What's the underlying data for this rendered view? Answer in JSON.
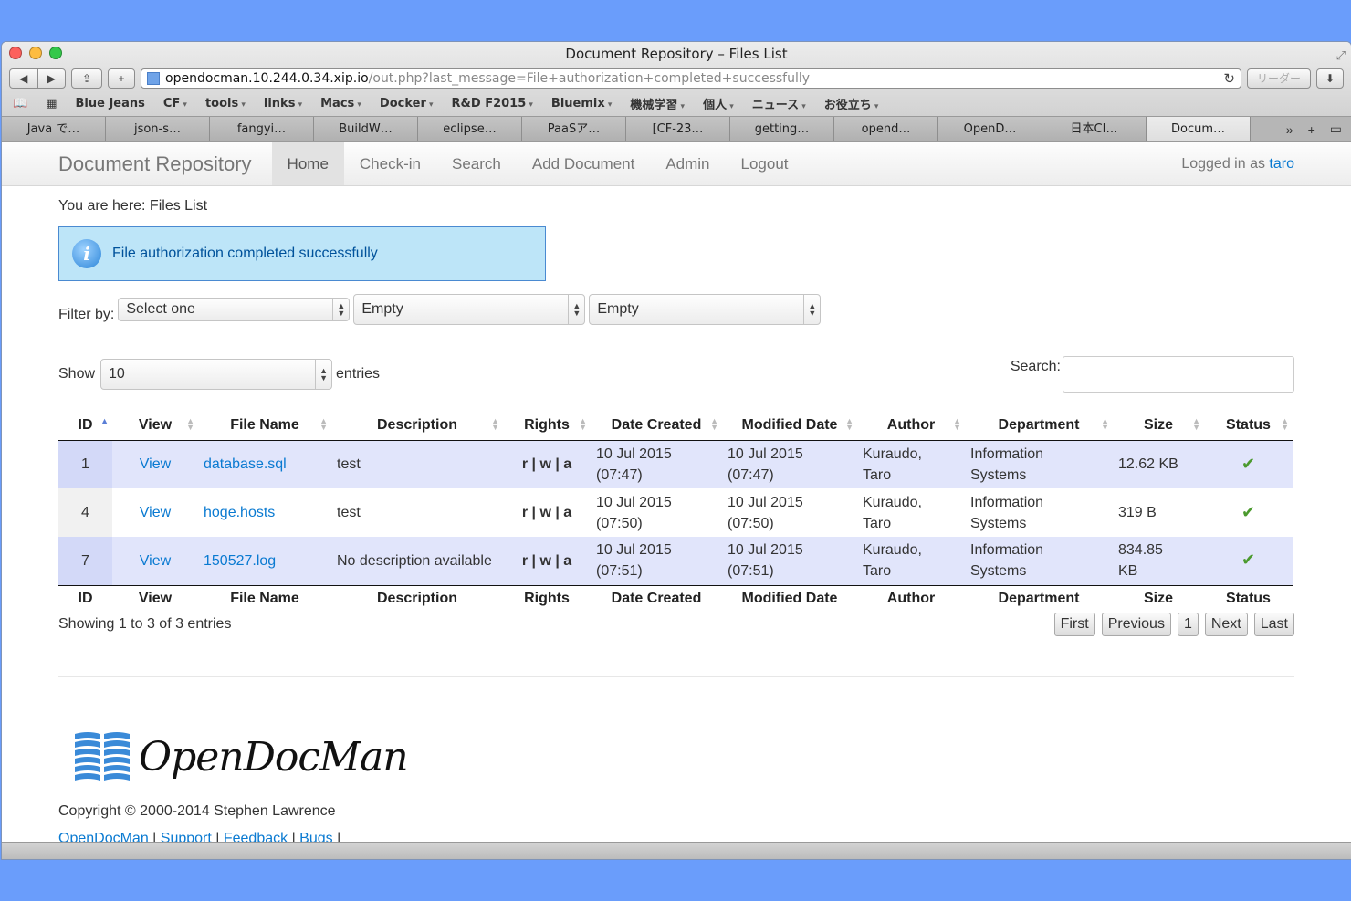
{
  "window": {
    "title": "Document Repository – Files List"
  },
  "toolbar": {
    "url_host": "opendocman.10.244.0.34.xip.io",
    "url_path": "/out.php?last_message=File+authorization+completed+successfully",
    "reader_label": "リーダー"
  },
  "bookmarks": [
    "Blue Jeans",
    "CF",
    "tools",
    "links",
    "Macs",
    "Docker",
    "R&D F2015",
    "Bluemix",
    "機械学習",
    "個人",
    "ニュース",
    "お役立ち"
  ],
  "tabs": [
    "Java で…",
    "json-s…",
    "fangyi…",
    "BuildW…",
    "eclipse…",
    "PaaSア…",
    "[CF-23…",
    "getting…",
    "opend…",
    "OpenD…",
    "日本CI…",
    "Docum…"
  ],
  "nav": {
    "brand": "Document Repository",
    "items": [
      "Home",
      "Check-in",
      "Search",
      "Add Document",
      "Admin",
      "Logout"
    ],
    "logged_in_prefix": "Logged in as",
    "user": "taro"
  },
  "breadcrumb": "You are here: Files List",
  "alert": {
    "message": "File authorization completed successfully"
  },
  "filter": {
    "label": "Filter by:",
    "select1": "Select one",
    "select2": "Empty",
    "select3": "Empty"
  },
  "length": {
    "show": "Show",
    "value": "10",
    "entries": "entries"
  },
  "search": {
    "label": "Search:"
  },
  "table": {
    "columns": [
      "ID",
      "View",
      "File Name",
      "Description",
      "Rights",
      "Date Created",
      "Modified Date",
      "Author",
      "Department",
      "Size",
      "Status"
    ],
    "rows": [
      {
        "id": "1",
        "view": "View",
        "file": "database.sql",
        "desc": "test",
        "rights": "r | w | a",
        "created1": "10 Jul 2015",
        "created2": "(07:47)",
        "modified1": "10 Jul 2015",
        "modified2": "(07:47)",
        "author1": "Kuraudo,",
        "author2": "Taro",
        "dept1": "Information",
        "dept2": "Systems",
        "size": "12.62 KB",
        "status": "✔"
      },
      {
        "id": "4",
        "view": "View",
        "file": "hoge.hosts",
        "desc": "test",
        "rights": "r | w | a",
        "created1": "10 Jul 2015",
        "created2": "(07:50)",
        "modified1": "10 Jul 2015",
        "modified2": "(07:50)",
        "author1": "Kuraudo,",
        "author2": "Taro",
        "dept1": "Information",
        "dept2": "Systems",
        "size": "319 B",
        "status": "✔"
      },
      {
        "id": "7",
        "view": "View",
        "file": "150527.log",
        "desc": "No description available",
        "rights": "r | w | a",
        "created1": "10 Jul 2015",
        "created2": "(07:51)",
        "modified1": "10 Jul 2015",
        "modified2": "(07:51)",
        "author1": "Kuraudo,",
        "author2": "Taro",
        "dept1": "Information",
        "dept2": "Systems",
        "size": "834.85 KB",
        "status": "✔"
      }
    ]
  },
  "info": "Showing 1 to 3 of 3 entries",
  "pager": [
    "First",
    "Previous",
    "1",
    "Next",
    "Last"
  ],
  "footer": {
    "logo_text": "OpenDocMan",
    "copyright": "Copyright © 2000-2014 Stephen Lawrence",
    "links": [
      "OpenDocMan",
      "Support",
      "Feedback",
      "Bugs"
    ]
  }
}
